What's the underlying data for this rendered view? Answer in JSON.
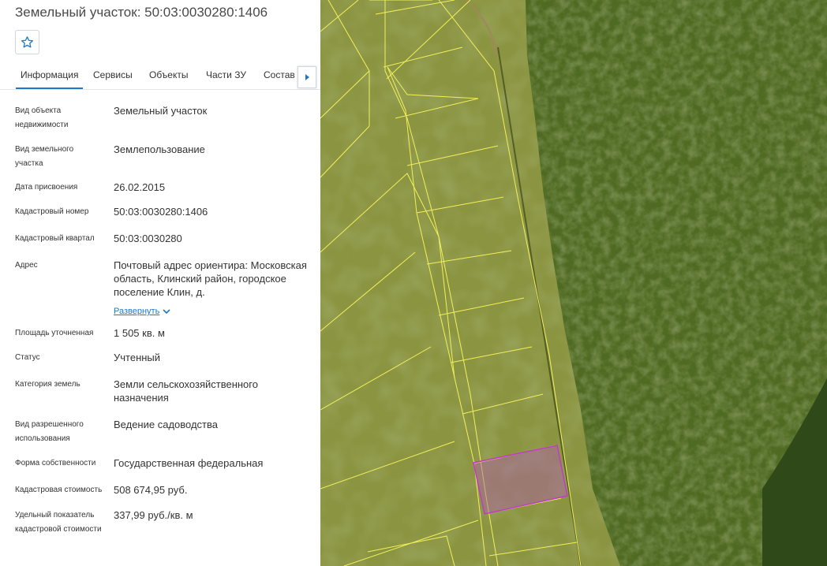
{
  "panel": {
    "title": "Земельный участок: 50:03:0030280:1406",
    "tabs": [
      "Информация",
      "Сервисы",
      "Объекты",
      "Части ЗУ",
      "Состав ЕЗП"
    ],
    "active_tab": "Информация",
    "fields": [
      {
        "label": "Вид объекта недвижимости",
        "value": "Земельный участок"
      },
      {
        "label": "Вид земельного участка",
        "value": "Землепользование"
      },
      {
        "label": "Дата присвоения",
        "value": "26.02.2015"
      },
      {
        "label": "Кадастровый номер",
        "value": "50:03:0030280:1406"
      },
      {
        "label": "Кадастровый квартал",
        "value": "50:03:0030280"
      },
      {
        "label": "Адрес",
        "value": "Почтовый адрес ориентира: Московская область, Клинский район, городское поселение Клин, д."
      },
      {
        "label": "Площадь уточненная",
        "value": "1 505 кв. м"
      },
      {
        "label": "Статус",
        "value": "Учтенный"
      },
      {
        "label": "Категория земель",
        "value": "Земли сельскохозяйственного назначения"
      },
      {
        "label": "Вид разрешенного использования",
        "value": "Ведение садоводства"
      },
      {
        "label": "Форма собственности",
        "value": "Государственная федеральная"
      },
      {
        "label": "Кадастровая стоимость",
        "value": "508 674,95 руб."
      },
      {
        "label": "Удельный показатель кадастровой стоимости",
        "value": "337,99 руб./кв. м"
      }
    ],
    "expand_label": "Развернуть"
  },
  "icons": {
    "favorite": "star-icon",
    "tabs_next": "caret-right-icon",
    "expand": "chevron-down-icon"
  },
  "colors": {
    "accent": "#1f77c9",
    "parcel_boundary": "#f2f05a",
    "selected_parcel": "#c23bc7"
  }
}
